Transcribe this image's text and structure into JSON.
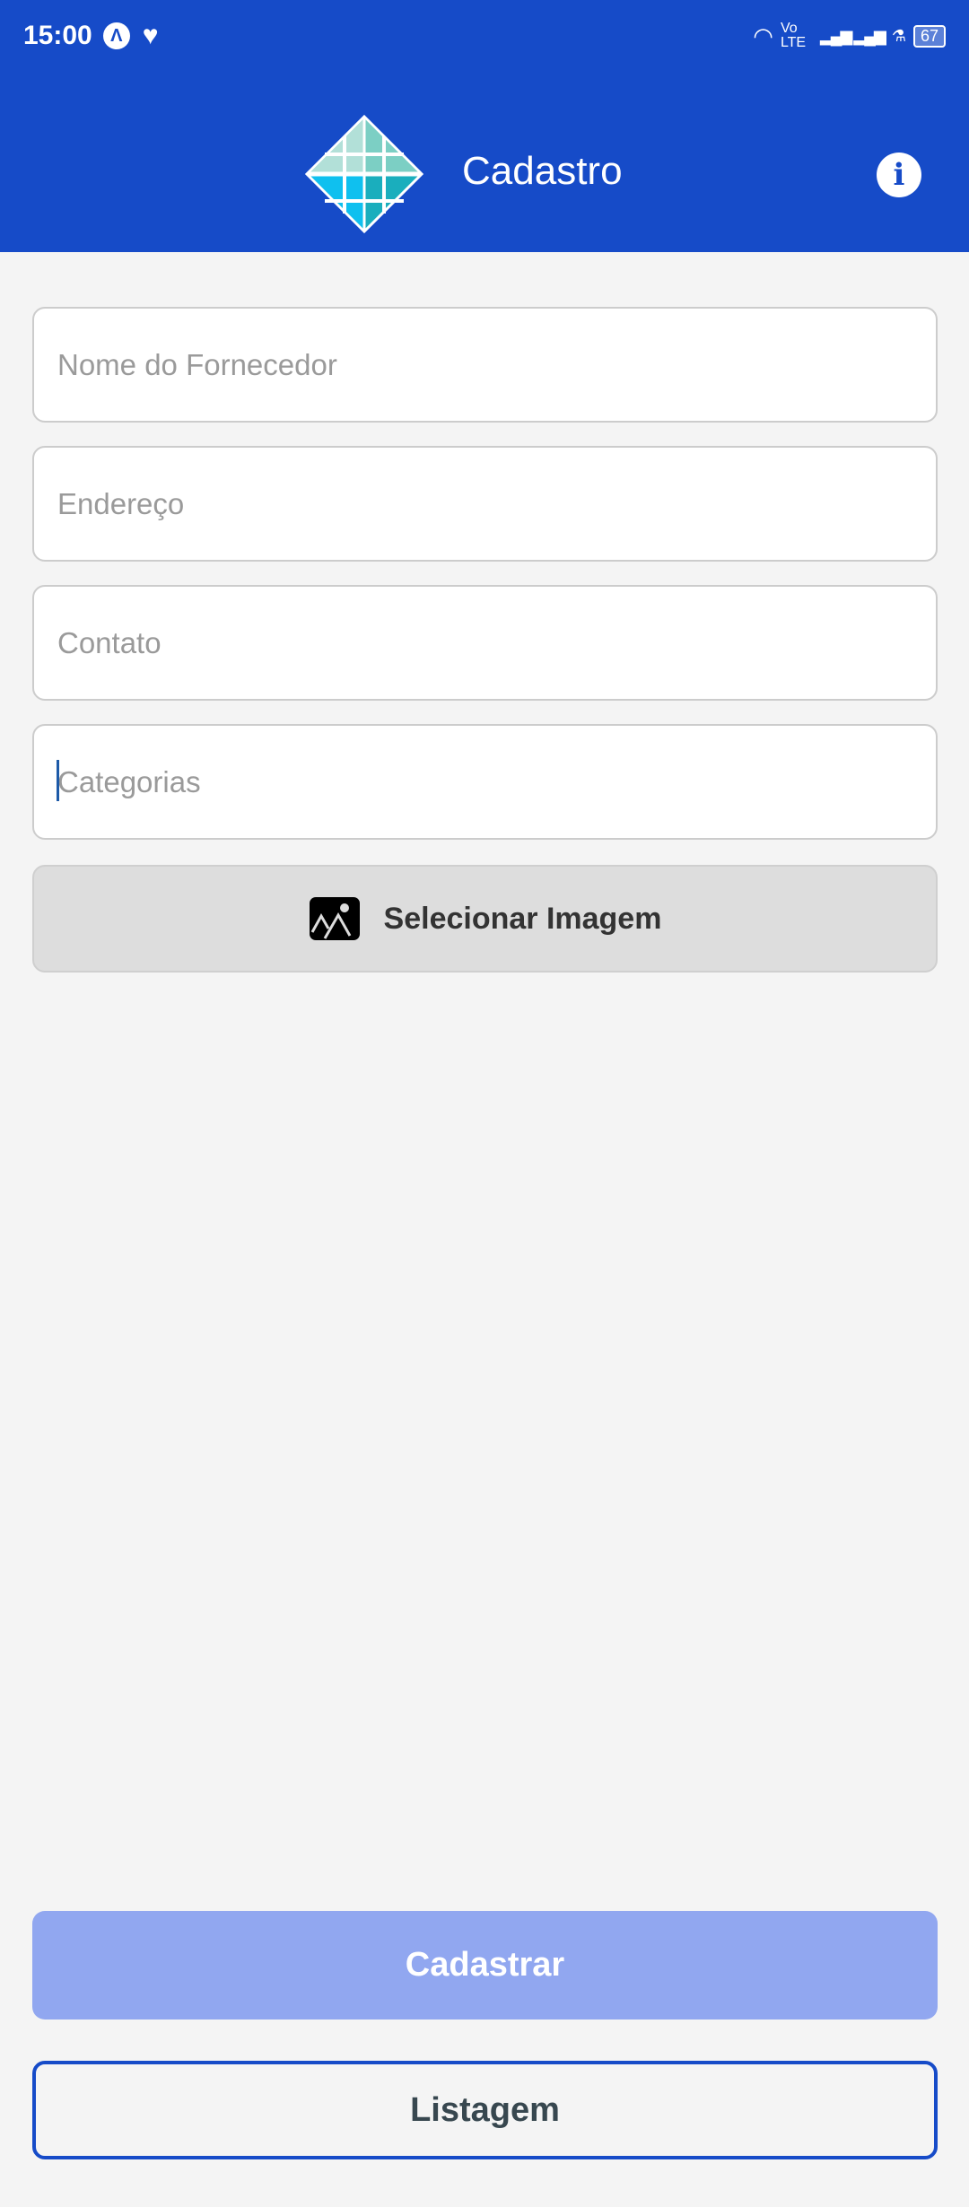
{
  "status_bar": {
    "time": "15:00",
    "network": "Vo LTE",
    "battery": "67"
  },
  "header": {
    "title": "Cadastro",
    "info_icon": "info-icon",
    "logo": "diamond-logo"
  },
  "form": {
    "supplier_name_placeholder": "Nome do Fornecedor",
    "address_placeholder": "Endereço",
    "contact_placeholder": "Contato",
    "categories_placeholder": "Categorias",
    "select_image_label": "Selecionar Imagem",
    "select_image_icon": "image-icon"
  },
  "actions": {
    "register_label": "Cadastrar",
    "list_label": "Listagem"
  },
  "colors": {
    "primary": "#164bc8",
    "register_disabled": "#91a7f0",
    "background": "#f4f4f4"
  }
}
